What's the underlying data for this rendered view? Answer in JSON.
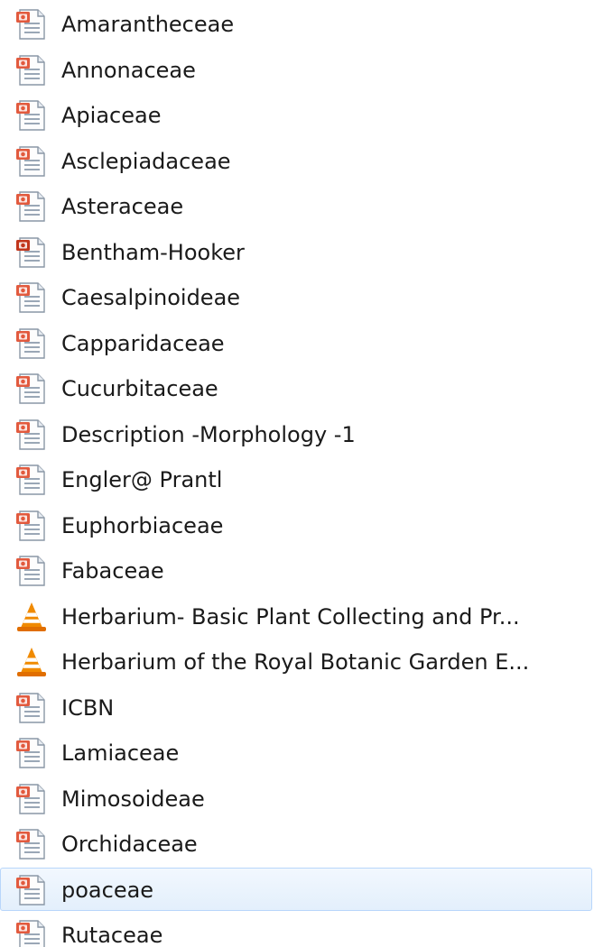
{
  "files": [
    {
      "name": "Amarantheceae",
      "icon": "powerpoint-icon"
    },
    {
      "name": "Annonaceae",
      "icon": "powerpoint-icon"
    },
    {
      "name": "Apiaceae",
      "icon": "powerpoint-icon"
    },
    {
      "name": "Asclepiadaceae",
      "icon": "powerpoint-icon"
    },
    {
      "name": "Asteraceae",
      "icon": "powerpoint-icon"
    },
    {
      "name": "Bentham-Hooker",
      "icon": "powerpoint-icon"
    },
    {
      "name": "Caesalpinoideae",
      "icon": "powerpoint-icon"
    },
    {
      "name": "Capparidaceae",
      "icon": "powerpoint-icon"
    },
    {
      "name": "Cucurbitaceae",
      "icon": "powerpoint-icon"
    },
    {
      "name": "Description -Morphology -1",
      "icon": "powerpoint-icon"
    },
    {
      "name": "Engler@ Prantl",
      "icon": "powerpoint-icon"
    },
    {
      "name": "Euphorbiaceae",
      "icon": "powerpoint-icon"
    },
    {
      "name": "Fabaceae",
      "icon": "powerpoint-icon"
    },
    {
      "name": "Herbarium- Basic Plant Collecting and Pr...",
      "icon": "vlc-media-icon"
    },
    {
      "name": "Herbarium of the Royal Botanic Garden E...",
      "icon": "vlc-media-icon"
    },
    {
      "name": "ICBN",
      "icon": "powerpoint-icon"
    },
    {
      "name": "Lamiaceae",
      "icon": "powerpoint-icon"
    },
    {
      "name": "Mimosoideae",
      "icon": "powerpoint-icon"
    },
    {
      "name": "Orchidaceae",
      "icon": "powerpoint-icon"
    },
    {
      "name": "poaceae",
      "icon": "powerpoint-icon",
      "selected": true
    },
    {
      "name": "Rutaceae",
      "icon": "powerpoint-icon"
    }
  ],
  "colors": {
    "selection_fill": "#e3effc",
    "selection_border": "#b8d6fb",
    "powerpoint_accent": "#d24726",
    "vlc_orange": "#f08a00"
  }
}
